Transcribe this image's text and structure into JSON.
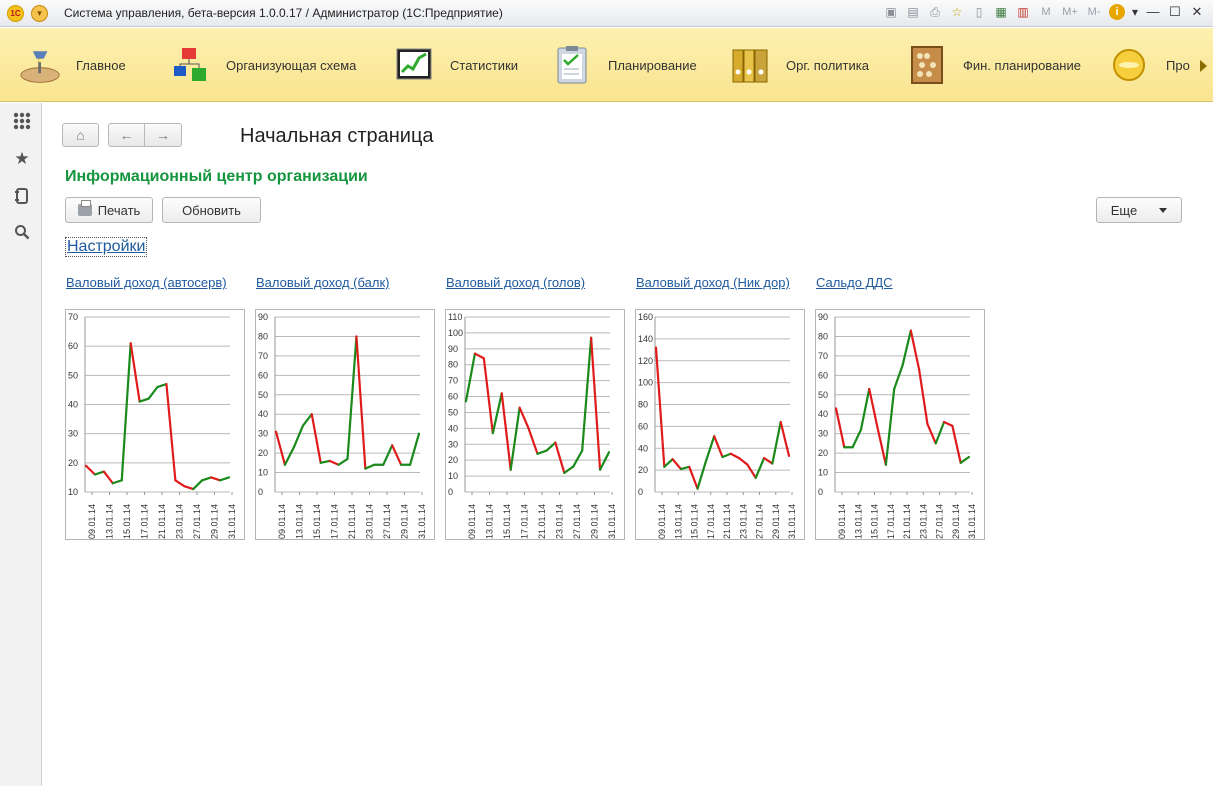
{
  "window": {
    "title": "Система управления, бета-версия 1.0.0.17 / Администратор  (1С:Предприятие)",
    "logo_text": "1С",
    "toolbar_labels": {
      "m": "M",
      "m_plus": "M+",
      "m_minus": "M-"
    }
  },
  "sections": [
    {
      "label": "Главное",
      "icon": "desk-lamp-icon"
    },
    {
      "label": "Организующая схема",
      "icon": "org-chart-icon"
    },
    {
      "label": "Статистики",
      "icon": "stats-chart-icon"
    },
    {
      "label": "Планирование",
      "icon": "clipboard-icon"
    },
    {
      "label": "Орг. политика",
      "icon": "folders-icon"
    },
    {
      "label": "Фин. планирование",
      "icon": "abacus-icon"
    },
    {
      "label": "Про",
      "icon": "coin-icon"
    }
  ],
  "sidebar": [
    "apps-grid-icon",
    "star-icon",
    "history-icon",
    "search-icon"
  ],
  "page": {
    "title": "Начальная страница",
    "info_title": "Информационный центр организации",
    "print_label": "Печать",
    "refresh_label": "Обновить",
    "more_label": "Еще",
    "settings_link": "Настройки"
  },
  "colors": {
    "up": "#1a8a1a",
    "down": "#e01b1b",
    "accent": "#15953e",
    "section_bg": "#fbe99b"
  },
  "chart_data": [
    {
      "type": "line",
      "title": "Валовый доход (автосерв)",
      "ylim": [
        10,
        70
      ],
      "yticks": [
        10,
        20,
        30,
        40,
        50,
        60,
        70
      ],
      "xticks": [
        "09.01.14",
        "13.01.14",
        "15.01.14",
        "17.01.14",
        "21.01.14",
        "23.01.14",
        "27.01.14",
        "29.01.14",
        "31.01.14"
      ],
      "values": [
        19,
        16,
        17,
        13,
        14,
        61,
        41,
        42,
        46,
        47,
        14,
        12,
        11,
        14,
        15,
        14,
        15
      ]
    },
    {
      "type": "line",
      "title": "Валовый доход (балк)",
      "ylim": [
        0,
        90
      ],
      "yticks": [
        0,
        10,
        20,
        30,
        40,
        50,
        60,
        70,
        80,
        90
      ],
      "xticks": [
        "09.01.14",
        "13.01.14",
        "15.01.14",
        "17.01.14",
        "21.01.14",
        "23.01.14",
        "27.01.14",
        "29.01.14",
        "31.01.14"
      ],
      "values": [
        31,
        14,
        23,
        34,
        40,
        15,
        16,
        14,
        17,
        80,
        12,
        14,
        14,
        24,
        14,
        14,
        30
      ]
    },
    {
      "type": "line",
      "title": "Валовый доход (голов)",
      "ylim": [
        0,
        110
      ],
      "yticks": [
        0,
        10,
        20,
        30,
        40,
        50,
        60,
        70,
        80,
        90,
        100,
        110
      ],
      "xticks": [
        "09.01.14",
        "13.01.14",
        "15.01.14",
        "17.01.14",
        "21.01.14",
        "23.01.14",
        "27.01.14",
        "29.01.14",
        "31.01.14"
      ],
      "values": [
        57,
        87,
        84,
        37,
        62,
        14,
        53,
        40,
        24,
        26,
        31,
        12,
        16,
        26,
        97,
        14,
        25
      ]
    },
    {
      "type": "line",
      "title": "Валовый доход (Ник дор)",
      "ylim": [
        0,
        160
      ],
      "yticks": [
        0,
        20,
        40,
        60,
        80,
        100,
        120,
        140,
        160
      ],
      "xticks": [
        "09.01.14",
        "13.01.14",
        "15.01.14",
        "17.01.14",
        "21.01.14",
        "23.01.14",
        "27.01.14",
        "29.01.14",
        "31.01.14"
      ],
      "values": [
        132,
        23,
        30,
        21,
        23,
        3,
        28,
        51,
        32,
        35,
        31,
        25,
        13,
        31,
        26,
        64,
        33
      ]
    },
    {
      "type": "line",
      "title": "Сальдо ДДС",
      "ylim": [
        0,
        90
      ],
      "yticks": [
        0,
        10,
        20,
        30,
        40,
        50,
        60,
        70,
        80,
        90
      ],
      "xticks": [
        "09.01.14",
        "13.01.14",
        "15.01.14",
        "17.01.14",
        "21.01.14",
        "23.01.14",
        "27.01.14",
        "29.01.14",
        "31.01.14"
      ],
      "values": [
        43,
        23,
        23,
        32,
        53,
        33,
        14,
        53,
        65,
        83,
        63,
        35,
        25,
        36,
        34,
        15,
        18
      ]
    }
  ]
}
